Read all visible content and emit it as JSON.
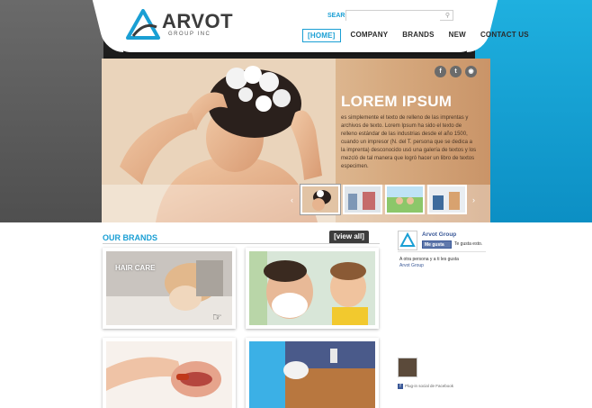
{
  "header": {
    "logo_text": "ARVOT",
    "logo_sub": "GROUP INC",
    "search_label": "SEARCH",
    "search_placeholder": "",
    "nav": [
      {
        "label": "[HOME]",
        "active": true
      },
      {
        "label": "COMPANY",
        "active": false
      },
      {
        "label": "BRANDS",
        "active": false
      },
      {
        "label": "NEW",
        "active": false
      },
      {
        "label": "CONTACT US",
        "active": false
      }
    ]
  },
  "hero": {
    "title": "LOREM IPSUM",
    "text": "es simplemente el texto de relleno de las imprentas y archivos de texto. Lorem Ipsum ha sido el texto de relleno estándar de las industrias desde el año 1500, cuando un impresor (N. del T. persona que se dedica a la imprenta) desconocido usó una galería de textos y los mezcló de tal manera que logró hacer un libro de textos especimen.",
    "social": [
      "f",
      "t",
      "◉"
    ],
    "prev_arrow": "‹",
    "next_arrow": "›"
  },
  "brands": {
    "title": "OUR BRANDS",
    "view_all": "[view all]",
    "cards": [
      {
        "label": "HAIR CARE"
      },
      {
        "label": ""
      },
      {
        "label": ""
      },
      {
        "label": ""
      }
    ]
  },
  "facebook": {
    "page_name": "Arvot Group",
    "like_button": "Me gusta",
    "likes_text": "Te gusta esto.",
    "other_text": "A otra persona y a ti les gusta",
    "link_text": "Arvot Group",
    "plugin_text": "Plug-in social de Facebook"
  },
  "colors": {
    "accent": "#1a9fd4",
    "dark": "#3d3d3d",
    "facebook": "#3b5998"
  }
}
